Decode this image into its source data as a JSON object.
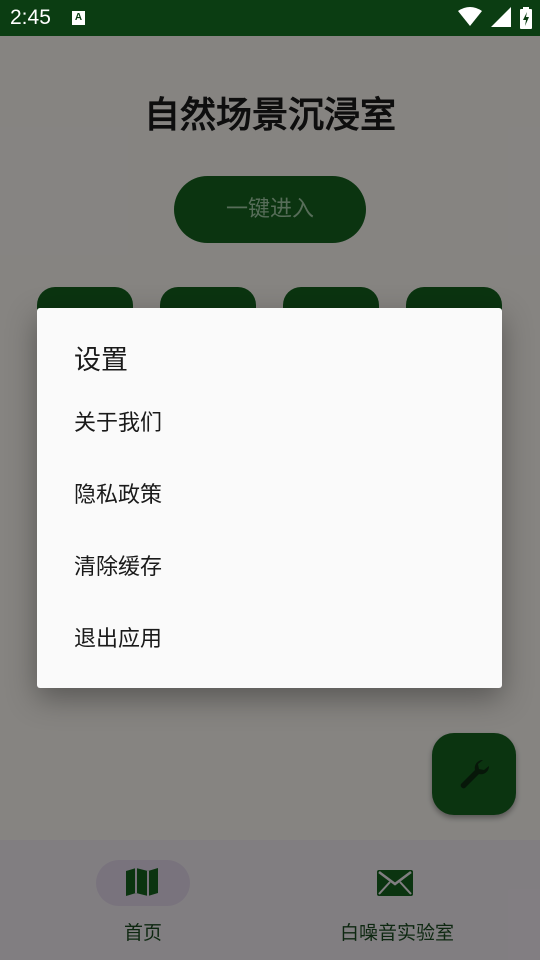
{
  "status_bar": {
    "time": "2:45",
    "notification_icon_letter": "A",
    "icons": [
      "wifi-icon",
      "signal-icon",
      "battery-charging-icon"
    ],
    "background": "#0b3d12"
  },
  "main": {
    "title": "自然场景沉浸室",
    "enter_button_label": "一键进入",
    "accent": "#14601e"
  },
  "fab": {
    "icon": "wrench-icon"
  },
  "bottom_nav": {
    "items": [
      {
        "label": "首页",
        "icon": "map-icon",
        "selected": true
      },
      {
        "label": "白噪音实验室",
        "icon": "mail-icon",
        "selected": false
      }
    ]
  },
  "dialog": {
    "title": "设置",
    "items": [
      {
        "label": "关于我们"
      },
      {
        "label": "隐私政策"
      },
      {
        "label": "清除缓存"
      },
      {
        "label": "退出应用"
      }
    ]
  }
}
